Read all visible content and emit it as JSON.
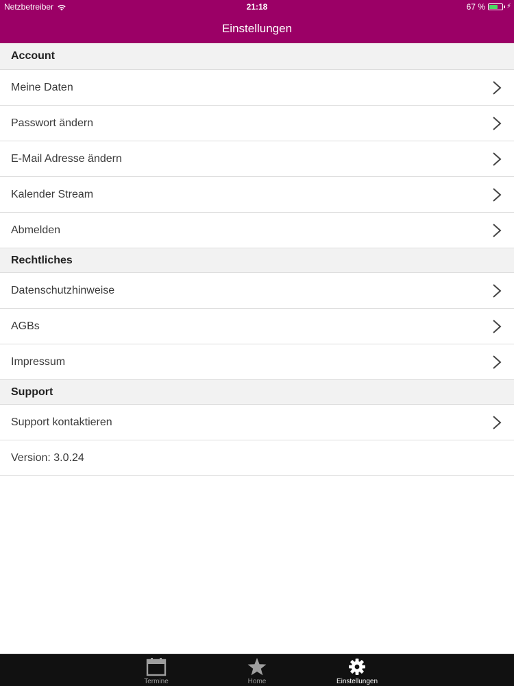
{
  "status_bar": {
    "carrier": "Netzbetreiber",
    "time": "21:18",
    "battery": "67 %",
    "battery_level": 0.67
  },
  "nav": {
    "title": "Einstellungen"
  },
  "sections": {
    "account": {
      "title": "Account",
      "items": [
        "Meine Daten",
        "Passwort ändern",
        "E-Mail Adresse ändern",
        "Kalender Stream",
        "Abmelden"
      ]
    },
    "legal": {
      "title": "Rechtliches",
      "items": [
        "Datenschutzhinweise",
        "AGBs",
        "Impressum"
      ]
    },
    "support": {
      "title": "Support",
      "items": [
        "Support kontaktieren"
      ],
      "version": "Version: 3.0.24"
    }
  },
  "tabbar": {
    "tabs": [
      {
        "label": "Termine",
        "icon": "calendar-icon"
      },
      {
        "label": "Home",
        "icon": "star-icon"
      },
      {
        "label": "Einstellungen",
        "icon": "gear-icon"
      }
    ],
    "active": "Einstellungen"
  },
  "colors": {
    "brand": "#9b0066",
    "tabbar_bg": "#111111",
    "section_bg": "#f2f2f2",
    "battery_fill": "#4cd964"
  }
}
